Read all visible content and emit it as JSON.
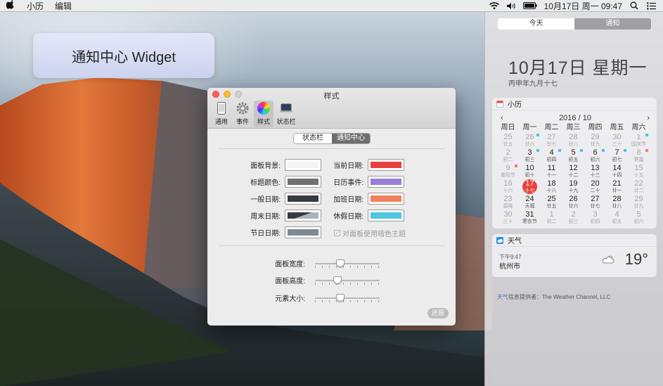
{
  "menubar": {
    "apple": "",
    "items": [
      "小历",
      "编辑"
    ],
    "clock": "10月17日 周一 09:47"
  },
  "widget_label": "通知中心 Widget",
  "prefs": {
    "title": "样式",
    "toolbar": [
      {
        "label": "通用",
        "icon": "phone-icon"
      },
      {
        "label": "事件",
        "icon": "gear-icon"
      },
      {
        "label": "样式",
        "icon": "color-wheel-icon",
        "active": true
      },
      {
        "label": "状态栏",
        "icon": "laptop-icon"
      }
    ],
    "tabs": [
      "状态栏",
      "通知中心"
    ],
    "active_tab": "通知中心",
    "colors_left": [
      {
        "label": "面板背景:",
        "color": "#f4f4f4"
      },
      {
        "label": "标题颜色:",
        "color": "#707070"
      },
      {
        "label": "一般日期:",
        "color": "#353b40"
      },
      {
        "label": "周末日期:",
        "color": "#353b40"
      },
      {
        "label": "节日日期:",
        "color": "#7d8a94"
      }
    ],
    "colors_right": [
      {
        "label": "当前日期:",
        "color": "#e8413c"
      },
      {
        "label": "日历事件:",
        "color": "#9b7fd6"
      },
      {
        "label": "加班日期:",
        "color": "#f08060"
      },
      {
        "label": "休假日期:",
        "color": "#4ec6e0"
      }
    ],
    "dark_theme_label": "对面板使用暗色主题",
    "sliders": [
      {
        "label": "面板宽度:",
        "value": 0.38
      },
      {
        "label": "面板高度:",
        "value": 0.33
      },
      {
        "label": "元素大小:",
        "value": 0.38
      }
    ],
    "restore_label": "还原"
  },
  "nc": {
    "tabs": [
      "今天",
      "通知"
    ],
    "date": "10月17日 星期一",
    "lunar": "丙申年九月十七",
    "calendar": {
      "app_name": "小历",
      "prev": "‹",
      "next": "›",
      "month_label": "2016 / 10",
      "weekdays": [
        "周日",
        "周一",
        "周二",
        "周三",
        "周四",
        "周五",
        "周六"
      ],
      "rows": [
        [
          [
            "25",
            "廿五",
            1,
            ""
          ],
          [
            "26",
            "廿六",
            1,
            "#4ec6e0"
          ],
          [
            "27",
            "廿七",
            1,
            ""
          ],
          [
            "28",
            "廿八",
            1,
            ""
          ],
          [
            "29",
            "廿九",
            1,
            ""
          ],
          [
            "30",
            "三十",
            1,
            ""
          ],
          [
            "1",
            "国庆节",
            1,
            "#4ec6e0"
          ]
        ],
        [
          [
            "2",
            "初二",
            1,
            ""
          ],
          [
            "3",
            "初三",
            0,
            "#4ec6e0"
          ],
          [
            "4",
            "初四",
            0,
            "#4ec6e0"
          ],
          [
            "5",
            "初五",
            0,
            "#4ec6e0"
          ],
          [
            "6",
            "初六",
            0,
            "#4ec6e0"
          ],
          [
            "7",
            "初七",
            0,
            "#4ec6e0"
          ],
          [
            "8",
            "寒露",
            1,
            "#f08060"
          ]
        ],
        [
          [
            "9",
            "重阳节",
            1,
            "#f08060"
          ],
          [
            "10",
            "初十",
            0,
            ""
          ],
          [
            "11",
            "十一",
            0,
            ""
          ],
          [
            "12",
            "十二",
            0,
            ""
          ],
          [
            "13",
            "十三",
            0,
            ""
          ],
          [
            "14",
            "十四",
            0,
            ""
          ],
          [
            "15",
            "十五",
            1,
            ""
          ]
        ],
        [
          [
            "16",
            "十六",
            1,
            ""
          ],
          [
            "17",
            "十七",
            2,
            ""
          ],
          [
            "18",
            "十八",
            0,
            ""
          ],
          [
            "19",
            "十九",
            0,
            ""
          ],
          [
            "20",
            "二十",
            0,
            ""
          ],
          [
            "21",
            "廿一",
            0,
            ""
          ],
          [
            "22",
            "廿二",
            1,
            ""
          ]
        ],
        [
          [
            "23",
            "霜降",
            1,
            ""
          ],
          [
            "24",
            "天福",
            0,
            ""
          ],
          [
            "25",
            "廿五",
            0,
            ""
          ],
          [
            "26",
            "廿六",
            0,
            ""
          ],
          [
            "27",
            "廿七",
            0,
            ""
          ],
          [
            "28",
            "廿八",
            0,
            ""
          ],
          [
            "29",
            "廿九",
            1,
            ""
          ]
        ],
        [
          [
            "30",
            "三十",
            1,
            ""
          ],
          [
            "31",
            "寒衣节",
            0,
            ""
          ],
          [
            "1",
            "初二",
            1,
            ""
          ],
          [
            "2",
            "初三",
            1,
            ""
          ],
          [
            "3",
            "初四",
            1,
            ""
          ],
          [
            "4",
            "初五",
            1,
            ""
          ],
          [
            "5",
            "初六",
            1,
            ""
          ]
        ]
      ]
    },
    "weather": {
      "title": "天气",
      "time": "下午9:47",
      "city": "杭州市",
      "temp": "19°"
    },
    "provider_prefix": "天气",
    "provider_text": "信息提供者：The Weather Channel, LLC"
  }
}
